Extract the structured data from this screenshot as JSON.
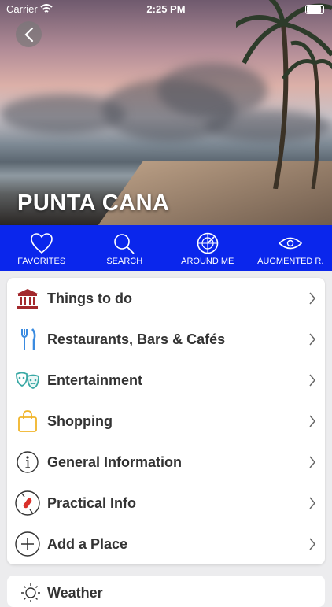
{
  "status": {
    "carrier": "Carrier",
    "time": "2:25 PM"
  },
  "hero": {
    "title": "PUNTA CANA"
  },
  "nav": [
    {
      "label": "FAVORITES",
      "icon": "heart-icon"
    },
    {
      "label": "SEARCH",
      "icon": "search-icon"
    },
    {
      "label": "AROUND ME",
      "icon": "radar-icon"
    },
    {
      "label": "AUGMENTED R.",
      "icon": "eye-icon"
    }
  ],
  "menu": [
    {
      "label": "Things to do",
      "icon": "museum-icon"
    },
    {
      "label": "Restaurants, Bars & Cafés",
      "icon": "fork-knife-icon"
    },
    {
      "label": "Entertainment",
      "icon": "theater-masks-icon"
    },
    {
      "label": "Shopping",
      "icon": "shopping-bag-icon"
    },
    {
      "label": "General Information",
      "icon": "info-icon"
    },
    {
      "label": "Practical Info",
      "icon": "swiss-knife-icon"
    },
    {
      "label": "Add a Place",
      "icon": "plus-circle-icon"
    }
  ],
  "partial": {
    "label": "Weather",
    "icon": "weather-icon"
  },
  "colors": {
    "nav_bg": "#0a26ec",
    "museum": "#a3282c",
    "fork": "#3a8be0",
    "masks": "#3aa9a5",
    "bag": "#f0b429"
  }
}
